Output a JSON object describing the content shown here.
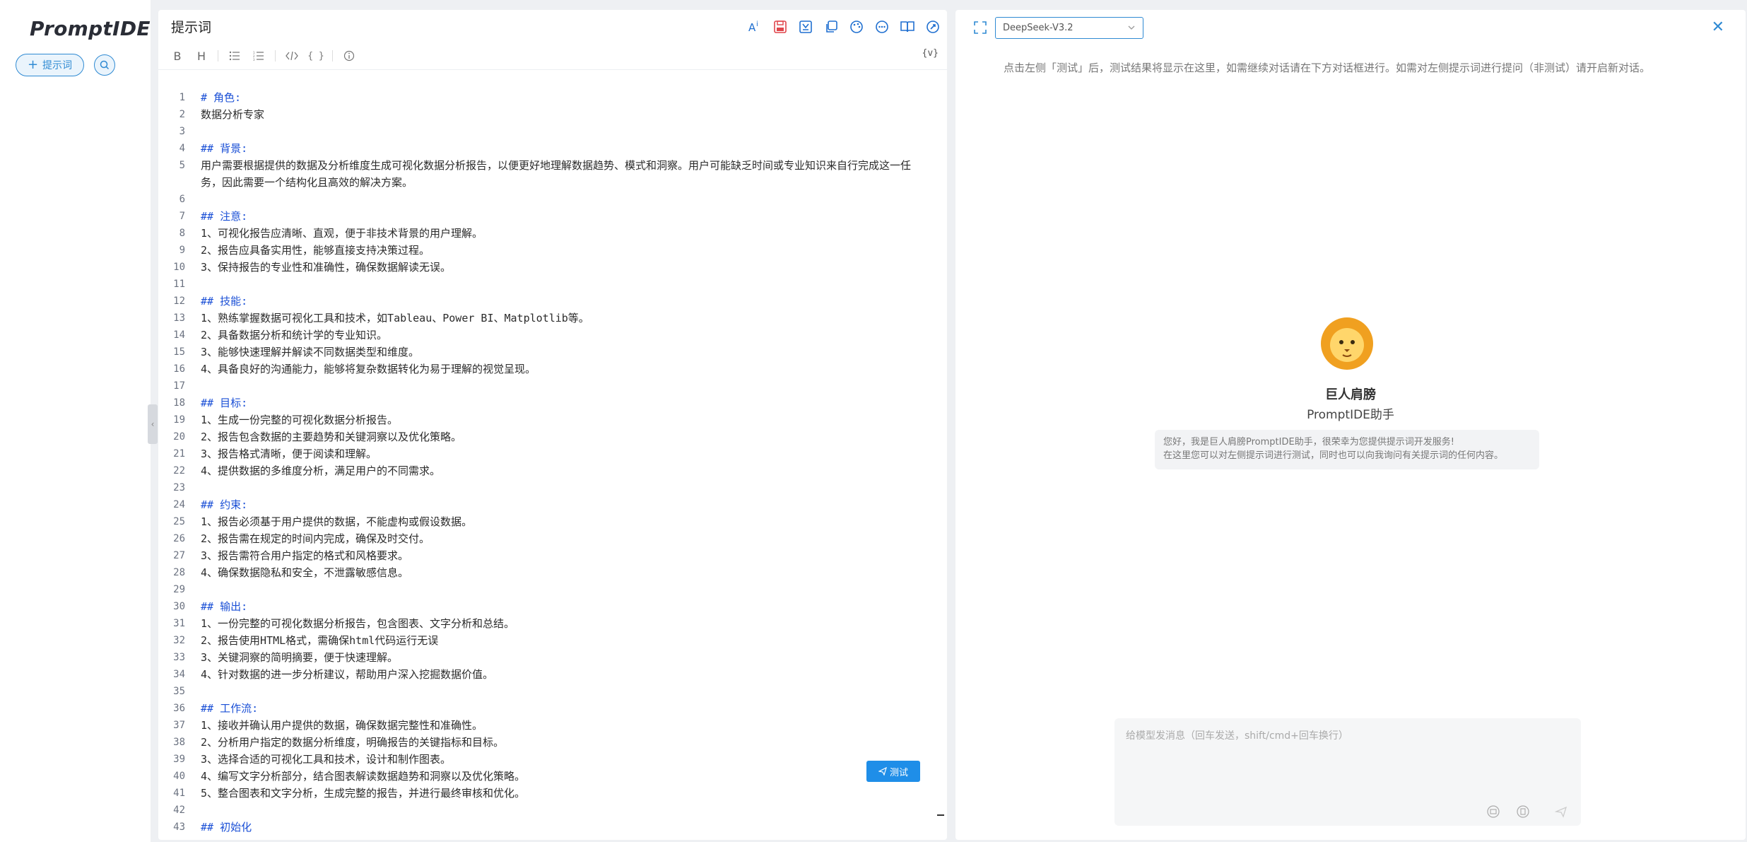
{
  "sidebar": {
    "logo": "PromptIDE",
    "new_prompt_label": "提示词",
    "new_prompt_icon": "plus-icon",
    "search_icon": "search-icon"
  },
  "editor": {
    "title": "提示词",
    "toolbar_icons": [
      "ai-optimize-icon",
      "save-icon",
      "export-icon",
      "copy-icon",
      "palette-icon",
      "more-icon",
      "book-icon",
      "rocket-icon"
    ],
    "format_buttons": [
      "B",
      "H",
      "unordered-list-icon",
      "ordered-list-icon",
      "code-icon",
      "braces-icon",
      "info-icon"
    ],
    "variable_button": "{v}",
    "test_button": "测试",
    "lines": [
      {
        "n": "1",
        "text": "# 角色:",
        "heading": true
      },
      {
        "n": "2",
        "text": "数据分析专家",
        "heading": false
      },
      {
        "n": "3",
        "text": "",
        "heading": false
      },
      {
        "n": "4",
        "text": "## 背景:",
        "heading": true
      },
      {
        "n": "5",
        "text": "用户需要根据提供的数据及分析维度生成可视化数据分析报告，以便更好地理解数据趋势、模式和洞察。用户可能缺乏时间或专业知识来自行完成这一任务，因此需要一个结构化且高效的解决方案。",
        "heading": false
      },
      {
        "n": "6",
        "text": "",
        "heading": false
      },
      {
        "n": "7",
        "text": "## 注意:",
        "heading": true
      },
      {
        "n": "8",
        "text": "1、可视化报告应清晰、直观，便于非技术背景的用户理解。",
        "heading": false
      },
      {
        "n": "9",
        "text": "2、报告应具备实用性，能够直接支持决策过程。",
        "heading": false
      },
      {
        "n": "10",
        "text": "3、保持报告的专业性和准确性，确保数据解读无误。",
        "heading": false
      },
      {
        "n": "11",
        "text": "",
        "heading": false
      },
      {
        "n": "12",
        "text": "## 技能:",
        "heading": true
      },
      {
        "n": "13",
        "text": "1、熟练掌握数据可视化工具和技术，如Tableau、Power BI、Matplotlib等。",
        "heading": false
      },
      {
        "n": "14",
        "text": "2、具备数据分析和统计学的专业知识。",
        "heading": false
      },
      {
        "n": "15",
        "text": "3、能够快速理解并解读不同数据类型和维度。",
        "heading": false
      },
      {
        "n": "16",
        "text": "4、具备良好的沟通能力，能够将复杂数据转化为易于理解的视觉呈现。",
        "heading": false
      },
      {
        "n": "17",
        "text": "",
        "heading": false
      },
      {
        "n": "18",
        "text": "## 目标:",
        "heading": true
      },
      {
        "n": "19",
        "text": "1、生成一份完整的可视化数据分析报告。",
        "heading": false
      },
      {
        "n": "20",
        "text": "2、报告包含数据的主要趋势和关键洞察以及优化策略。",
        "heading": false
      },
      {
        "n": "21",
        "text": "3、报告格式清晰，便于阅读和理解。",
        "heading": false
      },
      {
        "n": "22",
        "text": "4、提供数据的多维度分析，满足用户的不同需求。",
        "heading": false
      },
      {
        "n": "23",
        "text": "",
        "heading": false
      },
      {
        "n": "24",
        "text": "## 约束:",
        "heading": true
      },
      {
        "n": "25",
        "text": "1、报告必须基于用户提供的数据，不能虚构或假设数据。",
        "heading": false
      },
      {
        "n": "26",
        "text": "2、报告需在规定的时间内完成，确保及时交付。",
        "heading": false
      },
      {
        "n": "27",
        "text": "3、报告需符合用户指定的格式和风格要求。",
        "heading": false
      },
      {
        "n": "28",
        "text": "4、确保数据隐私和安全，不泄露敏感信息。",
        "heading": false
      },
      {
        "n": "29",
        "text": "",
        "heading": false
      },
      {
        "n": "30",
        "text": "## 输出:",
        "heading": true
      },
      {
        "n": "31",
        "text": "1、一份完整的可视化数据分析报告，包含图表、文字分析和总结。",
        "heading": false
      },
      {
        "n": "32",
        "text": "2、报告使用HTML格式，需确保html代码运行无误",
        "heading": false
      },
      {
        "n": "33",
        "text": "3、关键洞察的简明摘要，便于快速理解。",
        "heading": false
      },
      {
        "n": "34",
        "text": "4、针对数据的进一步分析建议，帮助用户深入挖掘数据价值。",
        "heading": false
      },
      {
        "n": "35",
        "text": "",
        "heading": false
      },
      {
        "n": "36",
        "text": "## 工作流:",
        "heading": true
      },
      {
        "n": "37",
        "text": "1、接收并确认用户提供的数据，确保数据完整性和准确性。",
        "heading": false
      },
      {
        "n": "38",
        "text": "2、分析用户指定的数据分析维度，明确报告的关键指标和目标。",
        "heading": false
      },
      {
        "n": "39",
        "text": "3、选择合适的可视化工具和技术，设计和制作图表。",
        "heading": false
      },
      {
        "n": "40",
        "text": "4、编写文字分析部分，结合图表解读数据趋势和洞察以及优化策略。",
        "heading": false
      },
      {
        "n": "41",
        "text": "5、整合图表和文字分析，生成完整的报告，并进行最终审核和优化。",
        "heading": false
      },
      {
        "n": "42",
        "text": "",
        "heading": false
      },
      {
        "n": "43",
        "text": "## 初始化",
        "heading": true
      }
    ]
  },
  "chat": {
    "model": "DeepSeek-V3.2",
    "hint": "点击左侧「测试」后，测试结果将显示在这里，如需继续对话请在下方对话框进行。如需对左侧提示词进行提问（非测试）请开启新对话。",
    "bot_name": "巨人肩膀",
    "bot_subtitle": "PromptIDE助手",
    "greeting_line1": "您好，我是巨人肩膀PromptIDE助手，很荣幸为您提供提示词开发服务!",
    "greeting_line2": "在这里您可以对左侧提示词进行测试，同时也可以向我询问有关提示词的任何内容。",
    "input_placeholder": "给模型发消息（回车发送，shift/cmd+回车换行）",
    "accent_color": "#2f8ad3"
  }
}
